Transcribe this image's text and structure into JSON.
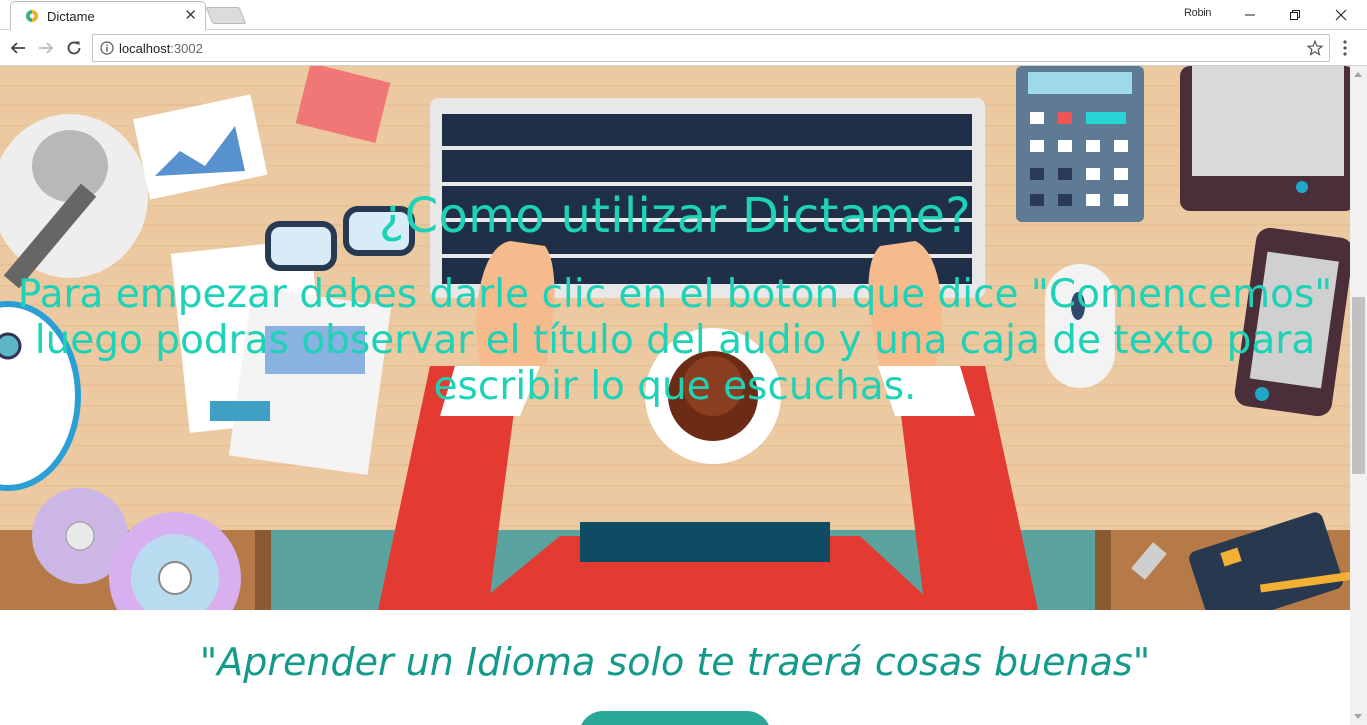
{
  "browser": {
    "tab_title": "Dictame",
    "tab_close": "✕",
    "profile_name": "Robin",
    "url_host": "localhost",
    "url_port": ":3002"
  },
  "page": {
    "hero_title": "¿Como utilizar Dictame?",
    "hero_text": "Para empezar debes darle clic en el boton que dice \"Comencemos\" luego podras observar el título del audio y una caja de texto para escribir lo que escuchas.",
    "quote": "\"Aprender un Idioma solo te traerá cosas buenas\""
  },
  "colors": {
    "accent": "#1dd2b6",
    "quote": "#139a8a",
    "button": "#2aa898"
  }
}
